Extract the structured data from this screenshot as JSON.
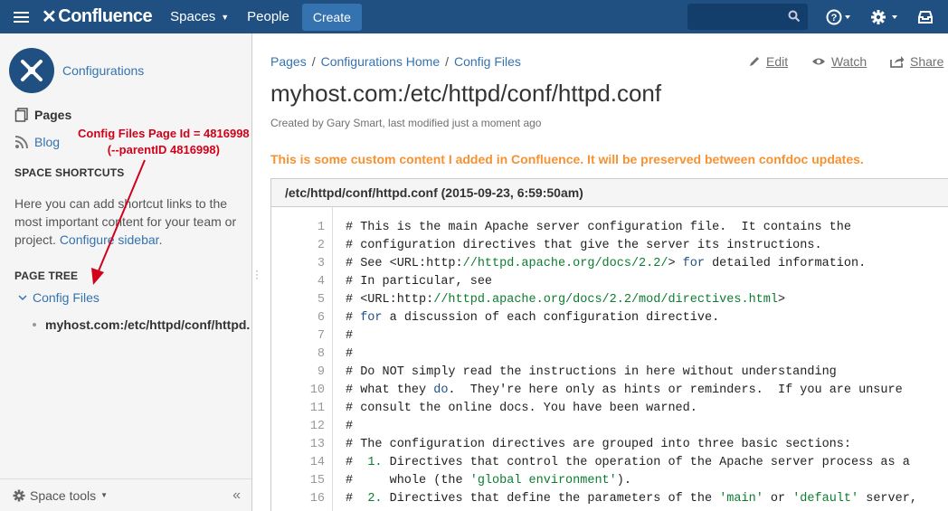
{
  "nav": {
    "logo": "Confluence",
    "spaces": "Spaces",
    "people": "People",
    "create": "Create"
  },
  "sidebar": {
    "space_name": "Configurations",
    "pages": "Pages",
    "blog": "Blog",
    "shortcuts_heading": "SPACE SHORTCUTS",
    "shortcuts_text": "Here you can add shortcut links to the most important content for your team or project.",
    "configure_sidebar": "Configure sidebar",
    "tree_heading": "PAGE TREE",
    "tree_parent": "Config Files",
    "tree_child": "myhost.com:/etc/httpd/conf/httpd.",
    "space_tools": "Space tools",
    "annotation_line1": "Config Files Page Id = 4816998",
    "annotation_line2": "(--parentID 4816998)"
  },
  "breadcrumb": [
    "Pages",
    "Configurations Home",
    "Config Files"
  ],
  "actions": {
    "edit": "Edit",
    "watch": "Watch",
    "share": "Share"
  },
  "page": {
    "title": "myhost.com:/etc/httpd/conf/httpd.conf",
    "byline": "Created by Gary Smart, last modified just a moment ago",
    "notice": "This is some custom content I added in Confluence. It will be preserved between confdoc updates."
  },
  "code": {
    "header": "/etc/httpd/conf/httpd.conf (2015-09-23, 6:59:50am)",
    "line_numbers": [
      "1",
      "2",
      "3",
      "4",
      "5",
      "6",
      "7",
      "8",
      "9",
      "10",
      "11",
      "12",
      "13",
      "14",
      "15",
      "16"
    ],
    "lines": [
      "# This is the main Apache server configuration file.  It contains the",
      "# configuration directives that give the server its instructions.",
      "# See <URL:http://httpd.apache.org/docs/2.2/> for detailed information.",
      "# In particular, see",
      "# <URL:http://httpd.apache.org/docs/2.2/mod/directives.html>",
      "# for a discussion of each configuration directive.",
      "#",
      "#",
      "# Do NOT simply read the instructions in here without understanding",
      "# what they do.  They're here only as hints or reminders.  If you are unsure",
      "# consult the online docs. You have been warned.",
      "#",
      "# The configuration directives are grouped into three basic sections:",
      "#  1. Directives that control the operation of the Apache server process as a",
      "#     whole (the 'global environment').",
      "#  2. Directives that define the parameters of the 'main' or 'default' server,"
    ]
  }
}
